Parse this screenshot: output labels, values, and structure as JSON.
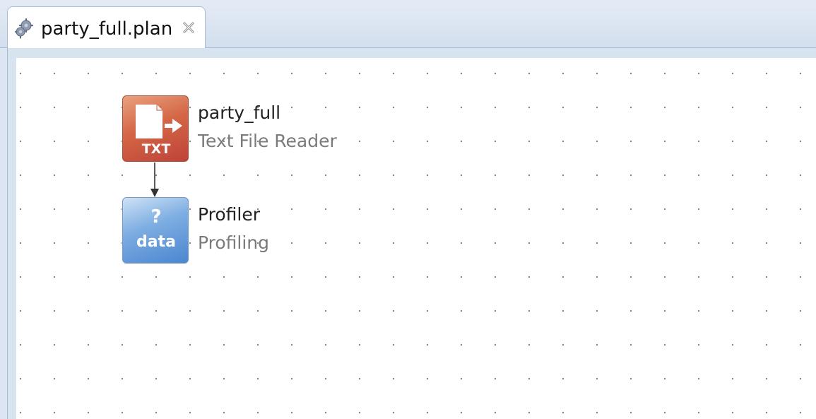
{
  "tab": {
    "title": "party_full.plan",
    "icon": "gears-icon",
    "close_icon": "close-icon"
  },
  "nodes": [
    {
      "name": "party_full",
      "type": "Text File Reader",
      "badge": "TXT",
      "icon": "text-file-reader-icon",
      "color": "#d0553e"
    },
    {
      "name": "Profiler",
      "type": "Profiling",
      "badge_symbol": "?",
      "badge": "data",
      "icon": "profiler-data-icon",
      "color": "#4f8ad0"
    }
  ],
  "connections": [
    {
      "from": "party_full",
      "to": "Profiler"
    }
  ]
}
